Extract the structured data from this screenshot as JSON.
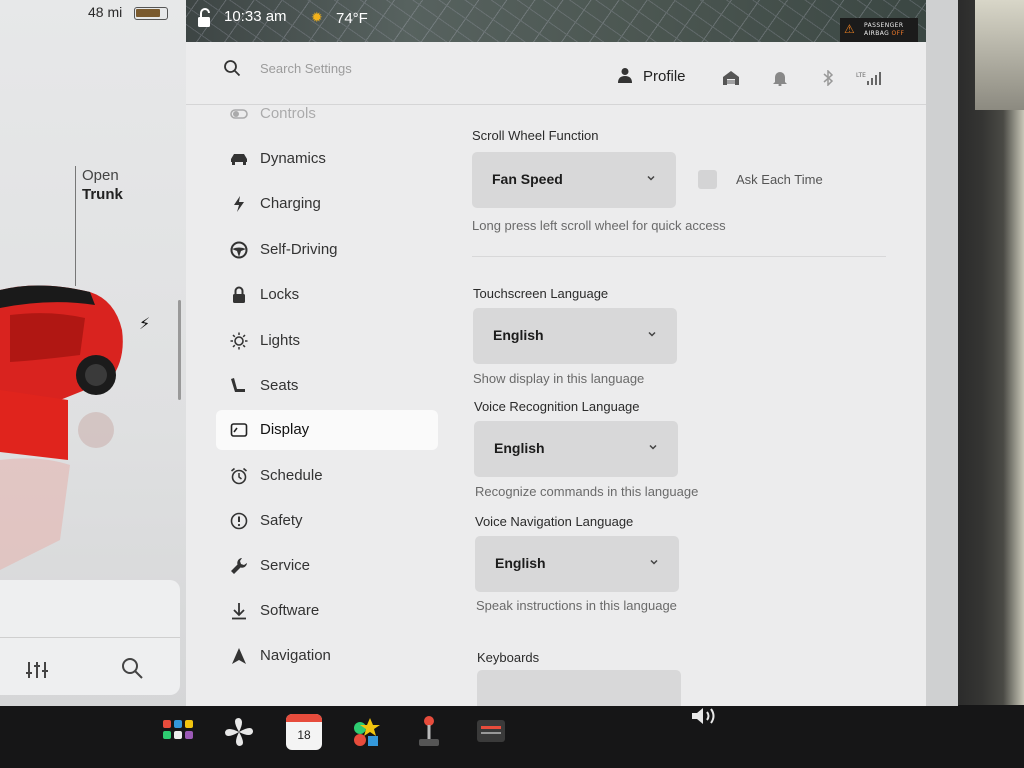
{
  "status": {
    "range": "48 mi",
    "battery_fraction": 0.85,
    "time": "10:33 am",
    "temperature": "74°F",
    "airbag": {
      "line1": "PASSENGER",
      "line2_prefix": "AIRBAG",
      "line2_state": "OFF"
    }
  },
  "car_panel": {
    "trunk_action": "Open",
    "trunk_label": "Trunk"
  },
  "header": {
    "search_placeholder": "Search Settings",
    "profile_label": "Profile",
    "signal_label": "LTE"
  },
  "sidebar": {
    "items": [
      {
        "label": "Controls",
        "icon": "toggle-icon"
      },
      {
        "label": "Dynamics",
        "icon": "car-icon"
      },
      {
        "label": "Charging",
        "icon": "bolt-icon"
      },
      {
        "label": "Self-Driving",
        "icon": "steering-wheel-icon"
      },
      {
        "label": "Locks",
        "icon": "lock-icon"
      },
      {
        "label": "Lights",
        "icon": "light-icon"
      },
      {
        "label": "Seats",
        "icon": "seat-icon"
      },
      {
        "label": "Display",
        "icon": "display-icon",
        "active": true
      },
      {
        "label": "Schedule",
        "icon": "alarm-clock-icon"
      },
      {
        "label": "Safety",
        "icon": "alert-icon"
      },
      {
        "label": "Service",
        "icon": "wrench-icon"
      },
      {
        "label": "Software",
        "icon": "download-icon"
      },
      {
        "label": "Navigation",
        "icon": "navigation-icon"
      }
    ]
  },
  "content": {
    "scroll_wheel": {
      "title": "Scroll Wheel Function",
      "value": "Fan Speed",
      "checkbox_label": "Ask Each Time",
      "checked": false,
      "helper": "Long press left scroll wheel for quick access"
    },
    "touchscreen_language": {
      "title": "Touchscreen Language",
      "value": "English",
      "helper": "Show display in this language"
    },
    "voice_recognition_language": {
      "title": "Voice Recognition Language",
      "value": "English",
      "helper": "Recognize commands in this language"
    },
    "voice_navigation_language": {
      "title": "Voice Navigation Language",
      "value": "English",
      "helper": "Speak instructions in this language"
    },
    "keyboards": {
      "title": "Keyboards"
    }
  },
  "dock": {
    "calendar_day": "18",
    "items": [
      "app-launcher-icon",
      "fan-icon",
      "calendar-icon",
      "toybox-icon",
      "arcade-icon",
      "dashcam-icon",
      "volume-icon"
    ]
  }
}
